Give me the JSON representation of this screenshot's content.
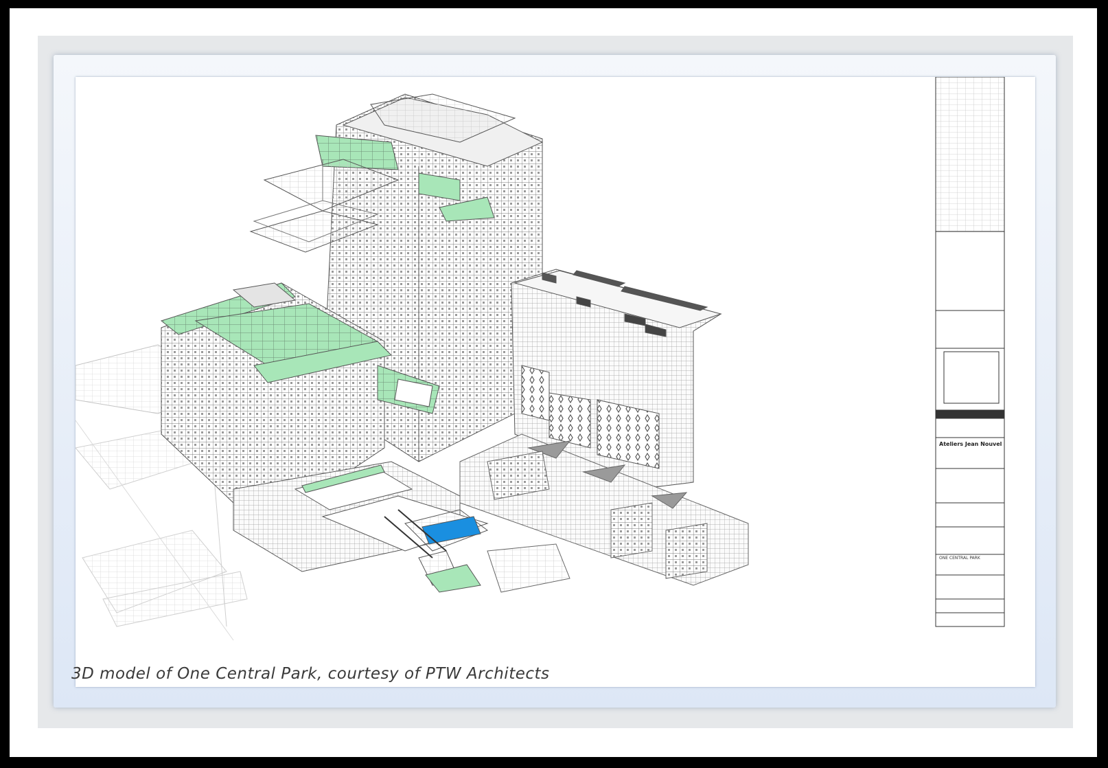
{
  "figure": {
    "caption": "3D model of One Central Park, courtesy of PTW Architects"
  },
  "colors": {
    "outer_border": "#000000",
    "terrace_green": "#a8e6b8",
    "pool_blue": "#1a8fe0",
    "line_gray": "#6a6a6a",
    "frame_blue": "#dde7f6"
  },
  "title_block": {
    "firm": "Ateliers Jean Nouvel",
    "project": "ONE CENTRAL PARK"
  }
}
